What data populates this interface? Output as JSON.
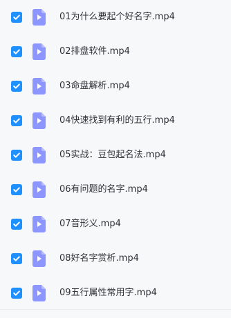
{
  "files": [
    {
      "name": "01为什么要起个好名字.mp4",
      "checked": true,
      "icon": "video-file-icon"
    },
    {
      "name": "02排盘软件.mp4",
      "checked": true,
      "icon": "video-file-icon"
    },
    {
      "name": "03命盘解析.mp4",
      "checked": true,
      "icon": "video-file-icon"
    },
    {
      "name": "04快速找到有利的五行.mp4",
      "checked": true,
      "icon": "video-file-icon"
    },
    {
      "name": "05实战：豆包起名法.mp4",
      "checked": true,
      "icon": "video-file-icon"
    },
    {
      "name": "06有问题的名字.mp4",
      "checked": true,
      "icon": "video-file-icon"
    },
    {
      "name": "07音形义.mp4",
      "checked": true,
      "icon": "video-file-icon"
    },
    {
      "name": "08好名字赏析.mp4",
      "checked": true,
      "icon": "video-file-icon"
    },
    {
      "name": "09五行属性常用字.mp4",
      "checked": true,
      "icon": "video-file-icon"
    }
  ],
  "colors": {
    "checkbox": "#1e90ff",
    "file_icon": "#8d95ff",
    "file_icon_fold": "#b8bdff",
    "text": "#2f3137",
    "background": "#f7f8fa"
  }
}
